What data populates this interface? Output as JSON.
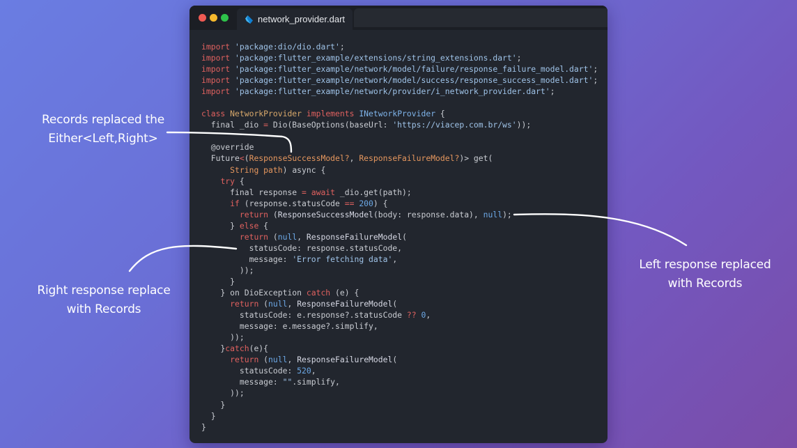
{
  "window": {
    "tab_label": "network_provider.dart",
    "tab_icon": "dart-icon",
    "traffic_lights": [
      "close",
      "minimize",
      "maximize"
    ]
  },
  "colors": {
    "background_start": "#6a7de2",
    "background_end": "#7a4ca8",
    "editor_bg": "#22262e",
    "titlebar_bg": "#1b1e24",
    "keyword": "#e0615f",
    "string": "#9fc3e8",
    "type": "#e6975e",
    "number": "#6ca8e6",
    "text": "#c9ccd2"
  },
  "code_lines": [
    [
      {
        "t": "kw",
        "v": "import"
      },
      {
        "t": "plain",
        "v": " "
      },
      {
        "t": "str",
        "v": "'package:dio/dio.dart'"
      },
      {
        "t": "plain",
        "v": ";"
      }
    ],
    [
      {
        "t": "kw",
        "v": "import"
      },
      {
        "t": "plain",
        "v": " "
      },
      {
        "t": "str",
        "v": "'package:flutter_example/extensions/string_extensions.dart'"
      },
      {
        "t": "plain",
        "v": ";"
      }
    ],
    [
      {
        "t": "kw",
        "v": "import"
      },
      {
        "t": "plain",
        "v": " "
      },
      {
        "t": "str",
        "v": "'package:flutter_example/network/model/failure/response_failure_model.dart'"
      },
      {
        "t": "plain",
        "v": ";"
      }
    ],
    [
      {
        "t": "kw",
        "v": "import"
      },
      {
        "t": "plain",
        "v": " "
      },
      {
        "t": "str",
        "v": "'package:flutter_example/network/model/success/response_success_model.dart'"
      },
      {
        "t": "plain",
        "v": ";"
      }
    ],
    [
      {
        "t": "kw",
        "v": "import"
      },
      {
        "t": "plain",
        "v": " "
      },
      {
        "t": "str",
        "v": "'package:flutter_example/network/provider/i_network_provider.dart'"
      },
      {
        "t": "plain",
        "v": ";"
      }
    ],
    [],
    [
      {
        "t": "kw",
        "v": "class"
      },
      {
        "t": "plain",
        "v": " "
      },
      {
        "t": "cls",
        "v": "NetworkProvider"
      },
      {
        "t": "plain",
        "v": " "
      },
      {
        "t": "kw",
        "v": "implements"
      },
      {
        "t": "plain",
        "v": " "
      },
      {
        "t": "iface",
        "v": "INetworkProvider"
      },
      {
        "t": "plain",
        "v": " {"
      }
    ],
    [
      {
        "t": "plain",
        "v": "  final _dio "
      },
      {
        "t": "kw",
        "v": "="
      },
      {
        "t": "plain",
        "v": " Dio(BaseOptions(baseUrl: "
      },
      {
        "t": "str",
        "v": "'https://viacep.com.br/ws'"
      },
      {
        "t": "plain",
        "v": "));"
      }
    ],
    [],
    [
      {
        "t": "plain",
        "v": "  @override"
      }
    ],
    [
      {
        "t": "plain",
        "v": "  Future"
      },
      {
        "t": "kw",
        "v": "<"
      },
      {
        "t": "plain",
        "v": "("
      },
      {
        "t": "type",
        "v": "ResponseSuccessModel?"
      },
      {
        "t": "plain",
        "v": ", "
      },
      {
        "t": "type",
        "v": "ResponseFailureModel?"
      },
      {
        "t": "plain",
        "v": ")> get("
      }
    ],
    [
      {
        "t": "plain",
        "v": "      "
      },
      {
        "t": "type",
        "v": "String"
      },
      {
        "t": "plain",
        "v": " "
      },
      {
        "t": "type",
        "v": "path"
      },
      {
        "t": "plain",
        "v": ") async {"
      }
    ],
    [
      {
        "t": "plain",
        "v": "    "
      },
      {
        "t": "kw",
        "v": "try"
      },
      {
        "t": "plain",
        "v": " {"
      }
    ],
    [
      {
        "t": "plain",
        "v": "      final response "
      },
      {
        "t": "kw",
        "v": "="
      },
      {
        "t": "plain",
        "v": " "
      },
      {
        "t": "kw",
        "v": "await"
      },
      {
        "t": "plain",
        "v": " _dio.get(path);"
      }
    ],
    [
      {
        "t": "plain",
        "v": "      "
      },
      {
        "t": "kw",
        "v": "if"
      },
      {
        "t": "plain",
        "v": " (response.statusCode "
      },
      {
        "t": "kw",
        "v": "=="
      },
      {
        "t": "plain",
        "v": " "
      },
      {
        "t": "num",
        "v": "200"
      },
      {
        "t": "plain",
        "v": ") {"
      }
    ],
    [
      {
        "t": "plain",
        "v": "        "
      },
      {
        "t": "kw",
        "v": "return"
      },
      {
        "t": "plain",
        "v": " ("
      },
      {
        "t": "cls2",
        "v": "ResponseSuccessModel"
      },
      {
        "t": "plain",
        "v": "(body: response.data), "
      },
      {
        "t": "num",
        "v": "null"
      },
      {
        "t": "plain",
        "v": ");"
      }
    ],
    [
      {
        "t": "plain",
        "v": "      } "
      },
      {
        "t": "kw",
        "v": "else"
      },
      {
        "t": "plain",
        "v": " {"
      }
    ],
    [
      {
        "t": "plain",
        "v": "        "
      },
      {
        "t": "kw",
        "v": "return"
      },
      {
        "t": "plain",
        "v": " ("
      },
      {
        "t": "num",
        "v": "null"
      },
      {
        "t": "plain",
        "v": ", "
      },
      {
        "t": "cls2",
        "v": "ResponseFailureModel"
      },
      {
        "t": "plain",
        "v": "("
      }
    ],
    [
      {
        "t": "plain",
        "v": "          statusCode: response.statusCode,"
      }
    ],
    [
      {
        "t": "plain",
        "v": "          message: "
      },
      {
        "t": "str",
        "v": "'Error fetching data'"
      },
      {
        "t": "plain",
        "v": ","
      }
    ],
    [
      {
        "t": "plain",
        "v": "        ));"
      }
    ],
    [
      {
        "t": "plain",
        "v": "      }"
      }
    ],
    [
      {
        "t": "plain",
        "v": "    } on DioException "
      },
      {
        "t": "kw",
        "v": "catch"
      },
      {
        "t": "plain",
        "v": " (e) {"
      }
    ],
    [
      {
        "t": "plain",
        "v": "      "
      },
      {
        "t": "kw",
        "v": "return"
      },
      {
        "t": "plain",
        "v": " ("
      },
      {
        "t": "num",
        "v": "null"
      },
      {
        "t": "plain",
        "v": ", "
      },
      {
        "t": "cls2",
        "v": "ResponseFailureModel"
      },
      {
        "t": "plain",
        "v": "("
      }
    ],
    [
      {
        "t": "plain",
        "v": "        statusCode: e.response?.statusCode "
      },
      {
        "t": "kw",
        "v": "??"
      },
      {
        "t": "plain",
        "v": " "
      },
      {
        "t": "num",
        "v": "0"
      },
      {
        "t": "plain",
        "v": ","
      }
    ],
    [
      {
        "t": "plain",
        "v": "        message: e.message?.simplify,"
      }
    ],
    [
      {
        "t": "plain",
        "v": "      ));"
      }
    ],
    [
      {
        "t": "plain",
        "v": "    }"
      },
      {
        "t": "kw",
        "v": "catch"
      },
      {
        "t": "plain",
        "v": "(e){"
      }
    ],
    [
      {
        "t": "plain",
        "v": "      "
      },
      {
        "t": "kw",
        "v": "return"
      },
      {
        "t": "plain",
        "v": " ("
      },
      {
        "t": "num",
        "v": "null"
      },
      {
        "t": "plain",
        "v": ", "
      },
      {
        "t": "cls2",
        "v": "ResponseFailureModel"
      },
      {
        "t": "plain",
        "v": "("
      }
    ],
    [
      {
        "t": "plain",
        "v": "        statusCode: "
      },
      {
        "t": "num",
        "v": "520"
      },
      {
        "t": "plain",
        "v": ","
      }
    ],
    [
      {
        "t": "plain",
        "v": "        message: "
      },
      {
        "t": "str",
        "v": "\"\""
      },
      {
        "t": "plain",
        "v": ".simplify,"
      }
    ],
    [
      {
        "t": "plain",
        "v": "      ));"
      }
    ],
    [
      {
        "t": "plain",
        "v": "    }"
      }
    ],
    [
      {
        "t": "plain",
        "v": "  }"
      }
    ],
    [
      {
        "t": "plain",
        "v": "}"
      }
    ]
  ],
  "annotations": {
    "records_either": {
      "line1": "Records replaced the",
      "line2": "Either<Left,Right>"
    },
    "right_response": {
      "line1": "Right response replace",
      "line2": "with Records"
    },
    "left_response": {
      "line1": "Left response replaced",
      "line2": "with Records"
    }
  }
}
